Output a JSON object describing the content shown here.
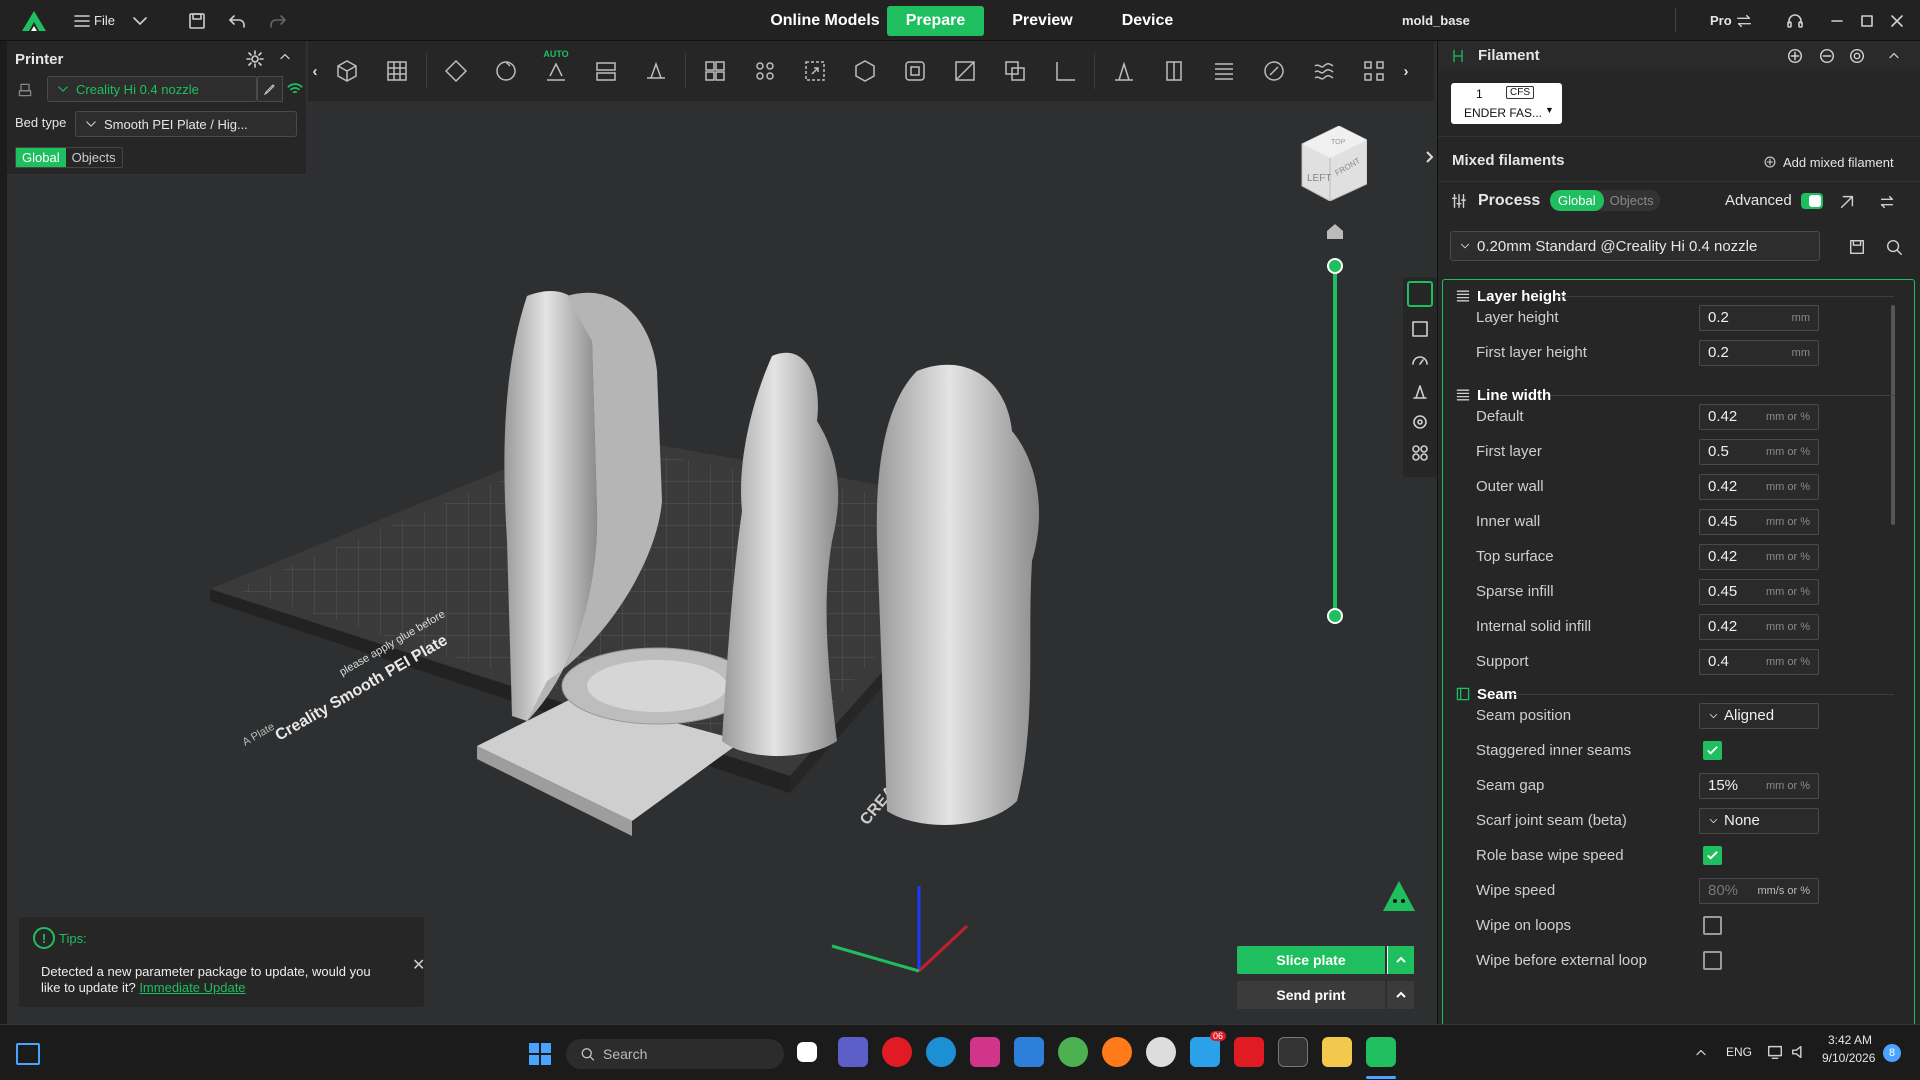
{
  "app": {
    "file_label": "File",
    "project_title": "mold_base",
    "pro_label": "Pro"
  },
  "nav": {
    "online_models": "Online Models",
    "prepare": "Prepare",
    "preview": "Preview",
    "device": "Device"
  },
  "printer": {
    "title": "Printer",
    "printer_name": "Creality Hi 0.4 nozzle",
    "bed_type_label": "Bed type",
    "bed_type_value": "Smooth PEI Plate / Hig...",
    "tab_global": "Global",
    "tab_objects": "Objects"
  },
  "toolbar": {
    "auto_label": "AUTO"
  },
  "viewcube": {
    "left": "LEFT",
    "front": "FRONT",
    "top": "TOP"
  },
  "plate": {
    "label": "Creality Smooth PEI Plate",
    "plate_a": "A Plate",
    "notice": "please apply glue before",
    "brand": "CREALITY"
  },
  "tips": {
    "title": "Tips:",
    "message": "Detected a new parameter package to update, would you like to update it?",
    "link": "Immediate Update"
  },
  "actions": {
    "slice": "Slice plate",
    "send": "Send print"
  },
  "filament": {
    "title": "Filament",
    "slot_number": "1",
    "cfs_label": "CFS",
    "slot_name": "ENDER FAS...",
    "mixed_title": "Mixed filaments",
    "add_mixed": "Add mixed filament"
  },
  "process": {
    "title": "Process",
    "tab_global": "Global",
    "tab_objects": "Objects",
    "advanced_label": "Advanced",
    "advanced_on": true,
    "profile": "0.20mm Standard @Creality Hi 0.4 nozzle"
  },
  "settings": {
    "layer_height_group": "Layer height",
    "layer_height": {
      "label": "Layer height",
      "value": "0.2",
      "unit": "mm"
    },
    "first_layer_height": {
      "label": "First layer height",
      "value": "0.2",
      "unit": "mm"
    },
    "line_width_group": "Line width",
    "lw_default": {
      "label": "Default",
      "value": "0.42",
      "unit": "mm or %"
    },
    "lw_first_layer": {
      "label": "First layer",
      "value": "0.5",
      "unit": "mm or %"
    },
    "lw_outer_wall": {
      "label": "Outer wall",
      "value": "0.42",
      "unit": "mm or %"
    },
    "lw_inner_wall": {
      "label": "Inner wall",
      "value": "0.45",
      "unit": "mm or %"
    },
    "lw_top_surface": {
      "label": "Top surface",
      "value": "0.42",
      "unit": "mm or %"
    },
    "lw_sparse_infill": {
      "label": "Sparse infill",
      "value": "0.45",
      "unit": "mm or %"
    },
    "lw_internal_solid": {
      "label": "Internal solid infill",
      "value": "0.42",
      "unit": "mm or %"
    },
    "lw_support": {
      "label": "Support",
      "value": "0.4",
      "unit": "mm or %"
    },
    "seam_group": "Seam",
    "seam_position": {
      "label": "Seam position",
      "value": "Aligned"
    },
    "staggered": {
      "label": "Staggered inner seams",
      "checked": true
    },
    "seam_gap": {
      "label": "Seam gap",
      "value": "15%",
      "unit": "mm or %"
    },
    "scarf": {
      "label": "Scarf joint seam (beta)",
      "value": "None"
    },
    "role_wipe": {
      "label": "Role base wipe speed",
      "checked": true
    },
    "wipe_speed": {
      "label": "Wipe speed",
      "value": "80%",
      "unit": "mm/s or %"
    },
    "wipe_loops": {
      "label": "Wipe on loops",
      "checked": false
    },
    "wipe_before": {
      "label": "Wipe before external loop",
      "checked": false
    }
  },
  "taskbar": {
    "search_placeholder": "Search",
    "lang": "ENG",
    "time": "3:42 AM",
    "date": "9/10/2026",
    "notif_count": "8",
    "mail_badge": "06"
  }
}
